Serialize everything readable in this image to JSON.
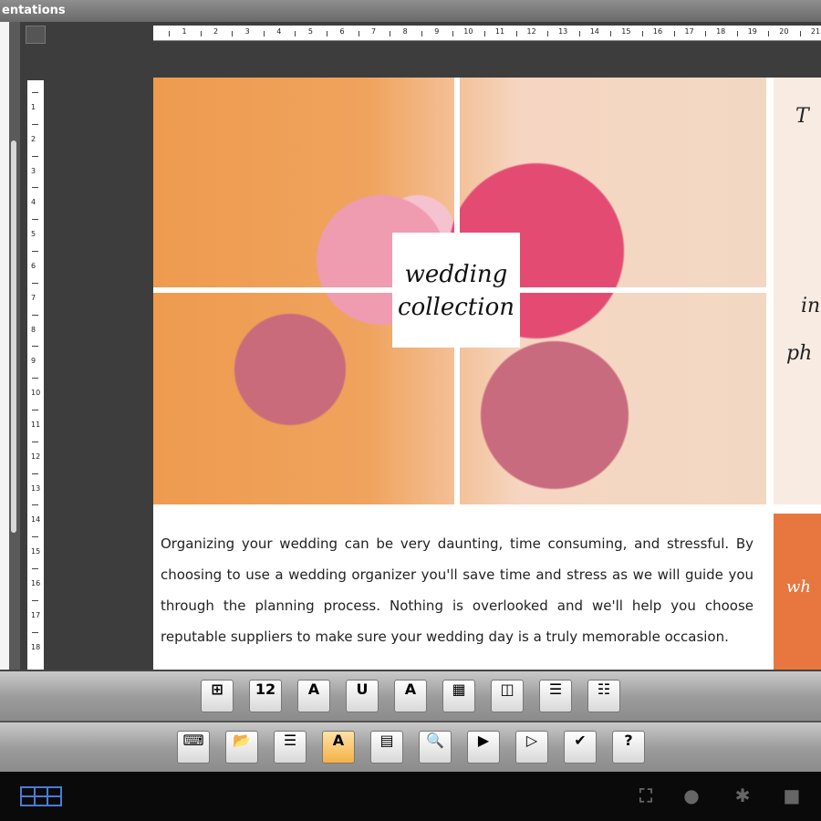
{
  "window": {
    "title": "entations"
  },
  "hruler_ticks": [
    "1",
    "2",
    "3",
    "4",
    "5",
    "6",
    "7",
    "8",
    "9",
    "10",
    "11",
    "12",
    "13",
    "14",
    "15",
    "16",
    "17",
    "18",
    "19",
    "20",
    "21"
  ],
  "vruler_ticks": [
    "1",
    "2",
    "3",
    "4",
    "5",
    "6",
    "7",
    "8",
    "9",
    "10",
    "11",
    "12",
    "13",
    "14",
    "15",
    "16",
    "17",
    "18"
  ],
  "slide": {
    "title_line1": "wedding",
    "title_line2": "collection",
    "body": "Organizing your wedding can be very daunting, time consuming, and stressful. By choosing to use a wedding organizer you'll save time and stress as we will guide you through the planning process. Nothing is overlooked and we'll help you choose reputable suppliers to make sure your wedding day is a truly memorable occasion.",
    "right_panel_fragments": [
      "T",
      "in",
      "ph",
      "wh"
    ]
  },
  "toolbar_row1": [
    {
      "name": "insert-image-button",
      "icon": "image-icon",
      "glyph": "⊞"
    },
    {
      "name": "page-number-button",
      "icon": "number-icon",
      "glyph": "12"
    },
    {
      "name": "font-size-button",
      "icon": "font-size-icon",
      "glyph": "A"
    },
    {
      "name": "underline-button",
      "icon": "underline-icon",
      "glyph": "U"
    },
    {
      "name": "font-color-button",
      "icon": "font-color-icon",
      "glyph": "A"
    },
    {
      "name": "insert-table-button",
      "icon": "table-icon",
      "glyph": "▦"
    },
    {
      "name": "shape-button",
      "icon": "shape-icon",
      "glyph": "◫"
    },
    {
      "name": "bullet-list-button",
      "icon": "bullet-list-icon",
      "glyph": "☰"
    },
    {
      "name": "numbered-list-button",
      "icon": "numbered-list-icon",
      "glyph": "☷"
    }
  ],
  "toolbar_row2": [
    {
      "name": "keyboard-button",
      "icon": "keyboard-icon",
      "glyph": "⌨"
    },
    {
      "name": "open-file-button",
      "icon": "folder-icon",
      "glyph": "📂"
    },
    {
      "name": "slide-layout-button",
      "icon": "layout-icon",
      "glyph": "☰"
    },
    {
      "name": "text-format-button",
      "icon": "text-icon",
      "glyph": "A",
      "active": true
    },
    {
      "name": "slide-view-button",
      "icon": "slide-icon",
      "glyph": "▤"
    },
    {
      "name": "zoom-button",
      "icon": "magnifier-icon",
      "glyph": "🔍"
    },
    {
      "name": "play-button",
      "icon": "play-icon",
      "glyph": "▶"
    },
    {
      "name": "play-from-current-button",
      "icon": "play-slide-icon",
      "glyph": "▷"
    },
    {
      "name": "save-button",
      "icon": "check-icon",
      "glyph": "✔"
    },
    {
      "name": "help-button",
      "icon": "help-icon",
      "glyph": "?"
    }
  ],
  "colors": {
    "accent_orange": "#e8773f",
    "toolbar": "#9c9c9c",
    "canvas": "#3d3d3d"
  }
}
